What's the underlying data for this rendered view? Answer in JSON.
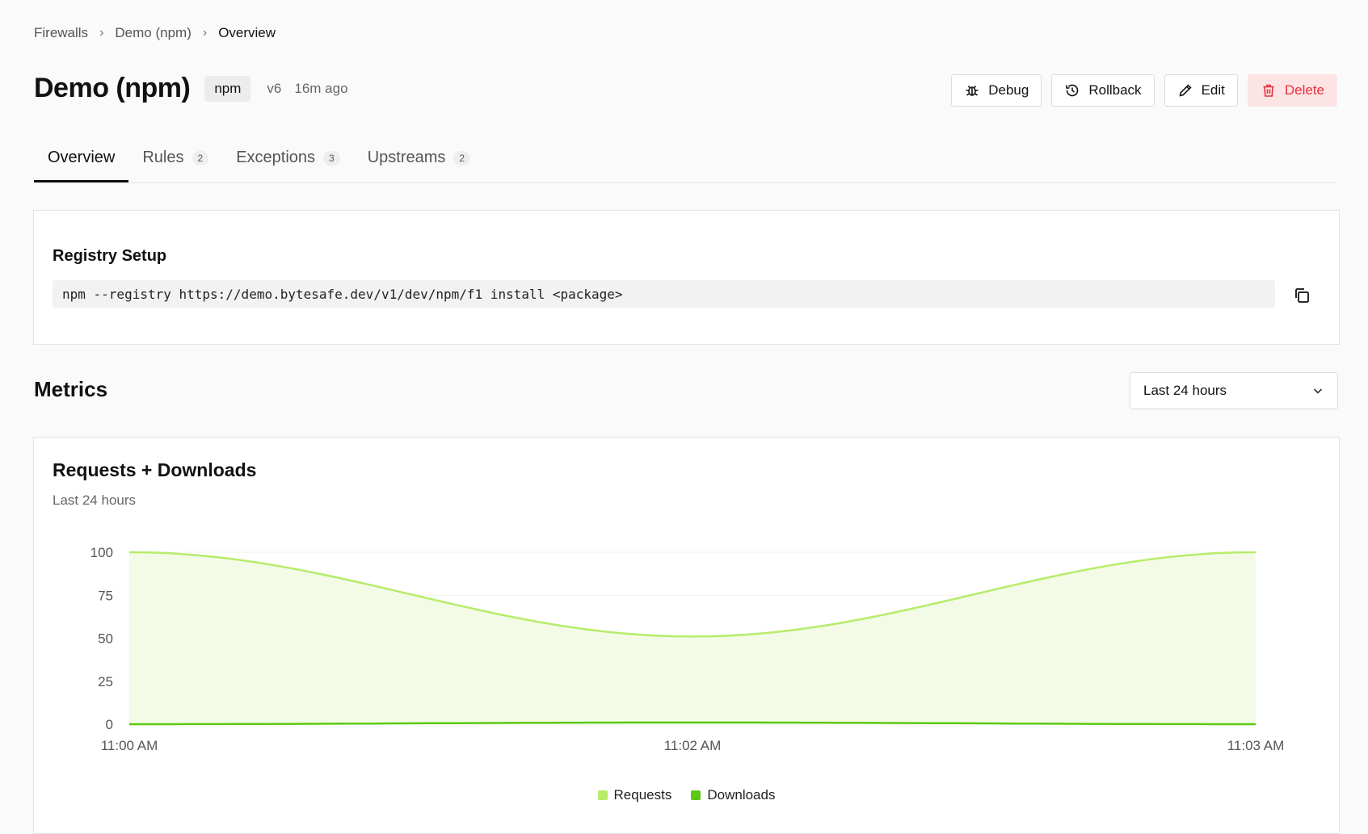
{
  "breadcrumb": {
    "items": [
      "Firewalls",
      "Demo (npm)"
    ],
    "current": "Overview"
  },
  "header": {
    "title": "Demo (npm)",
    "tag": "npm",
    "version": "v6",
    "updated": "16m ago"
  },
  "actions": {
    "debug": "Debug",
    "rollback": "Rollback",
    "edit": "Edit",
    "delete": "Delete"
  },
  "tabs": [
    {
      "label": "Overview",
      "count": null,
      "active": true
    },
    {
      "label": "Rules",
      "count": "2"
    },
    {
      "label": "Exceptions",
      "count": "3"
    },
    {
      "label": "Upstreams",
      "count": "2"
    }
  ],
  "registry": {
    "title": "Registry Setup",
    "command": "npm --registry https://demo.bytesafe.dev/v1/dev/npm/f1 install <package>"
  },
  "metrics": {
    "title": "Metrics",
    "range": "Last 24 hours"
  },
  "colors": {
    "requests": "#b7ec6a",
    "downloads": "#5cc912",
    "requests_fill": "#f3fbe6",
    "delete": "#e5303a"
  },
  "chart_data": {
    "type": "area",
    "title": "Requests + Downloads",
    "subtitle": "Last 24 hours",
    "x": [
      "11:00 AM",
      "11:02 AM",
      "11:03 AM"
    ],
    "x_ticks": [
      "11:00 AM",
      "11:02 AM",
      "11:03 AM"
    ],
    "y_ticks": [
      "100",
      "75",
      "50",
      "25",
      "0"
    ],
    "ylim": [
      0,
      100
    ],
    "series": [
      {
        "name": "Requests",
        "values": [
          100,
          51,
          100
        ]
      },
      {
        "name": "Downloads",
        "values": [
          0,
          1,
          0
        ]
      }
    ],
    "legend": "bottom-center",
    "grid": true
  }
}
